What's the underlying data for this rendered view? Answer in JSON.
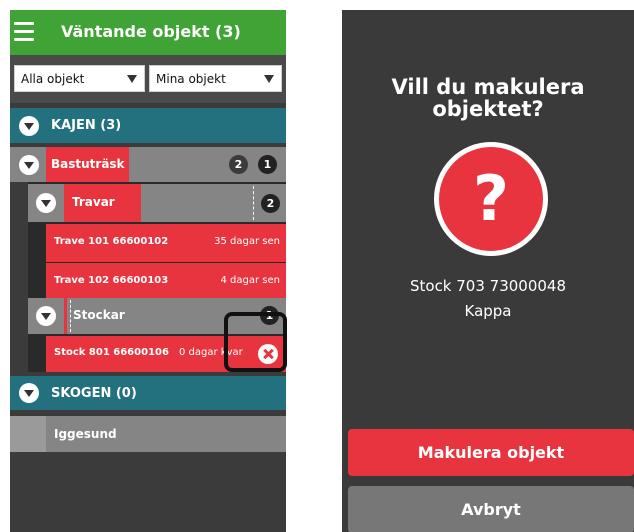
{
  "left": {
    "header": {
      "menu_icon": "hamburger-menu-icon",
      "title": "Väntande objekt (3)"
    },
    "filters": {
      "filter1": {
        "value": "Alla objekt"
      },
      "filter2": {
        "value": "Mina objekt"
      }
    },
    "groups": {
      "kajen": {
        "label": "KAJEN (3)"
      },
      "bastutrask": {
        "label": "Bastuträsk",
        "badge1": "2",
        "badge2": "1"
      },
      "travar": {
        "label": "Travar",
        "badge": "2"
      },
      "trave101": {
        "label": "Trave 101 66600102",
        "age": "35 dagar sen"
      },
      "trave102": {
        "label": "Trave 102 66600103",
        "age": "4 dagar sen"
      },
      "stockar": {
        "label": "Stockar",
        "badge": "1"
      },
      "stock801": {
        "label": "Stock 801 66600106",
        "age": "0 dagar kvar"
      },
      "skogen": {
        "label": "SKOGEN (0)"
      },
      "iggesund": {
        "label": "Iggesund"
      }
    }
  },
  "right": {
    "dialog": {
      "title": "Vill du makulera objektet?",
      "icon": "question-mark-icon",
      "object_line1": "Stock 703 73000048",
      "object_line2": "Kappa",
      "confirm_label": "Makulera objekt",
      "cancel_label": "Avbryt"
    }
  },
  "colors": {
    "green": "#3fa435",
    "teal": "#23707e",
    "red": "#e8343e",
    "gray_row": "#858585",
    "dark": "#3b3b3b"
  }
}
